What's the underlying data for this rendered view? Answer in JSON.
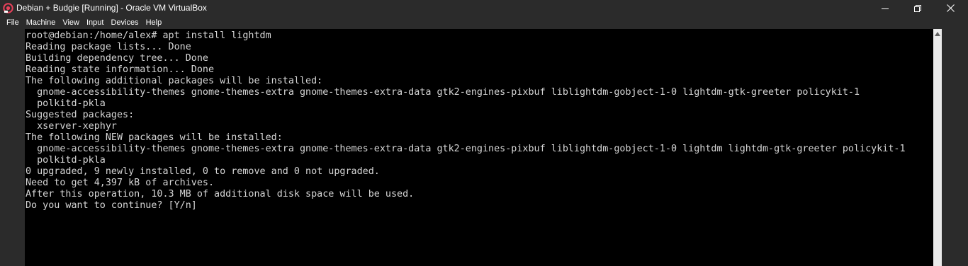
{
  "window": {
    "title": "Debian + Budgie [Running] - Oracle VM VirtualBox",
    "app_icon": "virtualbox-icon",
    "controls": {
      "minimize_icon": "minimize-icon",
      "maximize_icon": "restore-icon",
      "close_icon": "close-icon"
    }
  },
  "menubar": {
    "items": [
      "File",
      "Machine",
      "View",
      "Input",
      "Devices",
      "Help"
    ]
  },
  "terminal": {
    "lines": [
      "root@debian:/home/alex# apt install lightdm",
      "Reading package lists... Done",
      "Building dependency tree... Done",
      "Reading state information... Done",
      "The following additional packages will be installed:",
      "  gnome-accessibility-themes gnome-themes-extra gnome-themes-extra-data gtk2-engines-pixbuf liblightdm-gobject-1-0 lightdm-gtk-greeter policykit-1",
      "  polkitd-pkla",
      "Suggested packages:",
      "  xserver-xephyr",
      "The following NEW packages will be installed:",
      "  gnome-accessibility-themes gnome-themes-extra gnome-themes-extra-data gtk2-engines-pixbuf liblightdm-gobject-1-0 lightdm lightdm-gtk-greeter policykit-1",
      "  polkitd-pkla",
      "0 upgraded, 9 newly installed, 0 to remove and 0 not upgraded.",
      "Need to get 4,397 kB of archives.",
      "After this operation, 10.3 MB of additional disk space will be used.",
      "Do you want to continue? [Y/n]"
    ]
  },
  "colors": {
    "chrome_background": "#2b2b2b",
    "terminal_background": "#000000",
    "terminal_text": "#d6d6d6",
    "scrollbar": "#eaeaea",
    "icon_accent": "#e8415b"
  }
}
